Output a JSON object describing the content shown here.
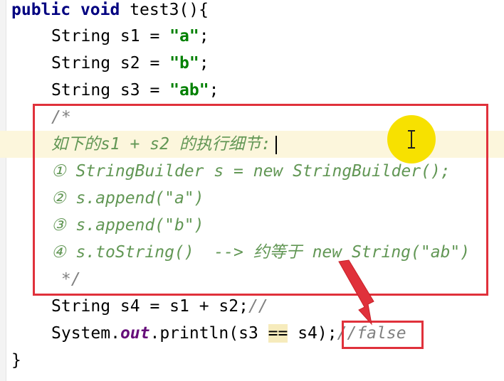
{
  "code": {
    "sig_public": "public",
    "sig_void": "void",
    "sig_rest": " test3(){",
    "l1_pre": "String s1 = ",
    "l1_str": "\"a\"",
    "l1_end": ";",
    "l2_pre": "String s2 = ",
    "l2_str": "\"b\"",
    "l2_end": ";",
    "l3_pre": "String s3 = ",
    "l3_str": "\"ab\"",
    "l3_end": ";",
    "c_open": "/*",
    "c1": "如下的s1 + s2 的执行细节:",
    "c2": "① StringBuilder s = new StringBuilder();",
    "c3": "② s.append(\"a\")",
    "c4": "③ s.append(\"b\")",
    "c5": "④ s.toString()  --> 约等于 new String(\"ab\")",
    "c_close": " */",
    "l4": "String s4 = s1 + s2;",
    "l4_cmt": "//",
    "l5_a": "System.",
    "l5_field": "out",
    "l5_b": ".println(s3 ",
    "l5_eq": "==",
    "l5_c": " s4);",
    "l5_cmt": "//false",
    "closing": "}"
  },
  "colors": {
    "annotation_red": "#e0313b",
    "cursor_highlight": "#f7e100",
    "comment_green": "#629755",
    "string_green": "#008000",
    "keyword_navy": "#000080"
  },
  "icons": {
    "text_cursor": "i-beam-cursor-icon",
    "annotation_arrow": "red-arrow-icon"
  }
}
